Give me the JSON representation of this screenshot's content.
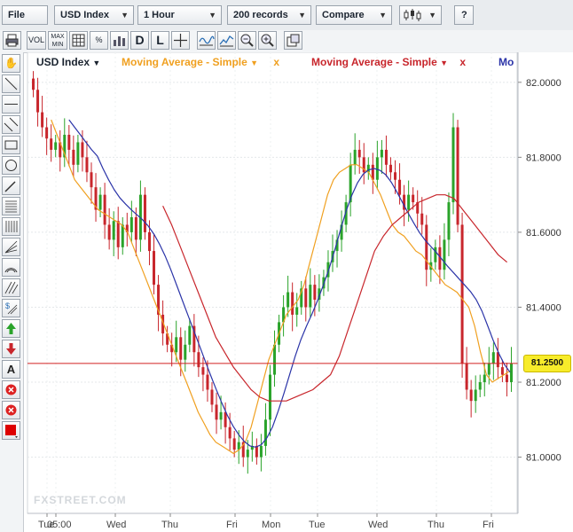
{
  "toolbar": {
    "file": "File",
    "instrument": "USD Index",
    "timeframe": "1 Hour",
    "records": "200 records",
    "compare": "Compare",
    "help": "?",
    "vol": "VOL",
    "maxmin": "MAX MIN",
    "pct": "%",
    "d": "D",
    "l": "L"
  },
  "legend": {
    "instrument": "USD Index",
    "ma1": "Moving Average - Simple",
    "ma2": "Moving Average - Simple",
    "ma3": "Mo",
    "remove": "x",
    "dropdown": "▼"
  },
  "colors": {
    "up": "#2aa32a",
    "down": "#c8262c",
    "ma_fast": "#f0a020",
    "ma_slow": "#c8262c",
    "ma_mid": "#2b34a8",
    "price_line": "#d02020"
  },
  "price_label": "81.2500",
  "watermark": "FXSTREET.COM",
  "chart_data": {
    "type": "line",
    "title": "USD Index",
    "ylim": [
      80.85,
      82.08
    ],
    "y_ticks": [
      "82.0000",
      "81.8000",
      "81.6000",
      "81.4000",
      "81.2000",
      "81.0000"
    ],
    "y_tick_values": [
      82.0,
      81.8,
      81.6,
      81.4,
      81.2,
      81.0
    ],
    "x_labels": [
      "Tue",
      "05:00",
      "Wed",
      "Thu",
      "Fri",
      "Mon",
      "Tue",
      "Wed",
      "Thu",
      "Fri"
    ],
    "current_price": 81.25,
    "series": [
      {
        "name": "USD Index",
        "type": "candlestick",
        "close": [
          81.98,
          81.92,
          81.88,
          81.85,
          81.82,
          81.84,
          81.8,
          81.86,
          81.82,
          81.78,
          81.84,
          81.8,
          81.76,
          81.72,
          81.66,
          81.7,
          81.62,
          81.58,
          81.63,
          81.56,
          81.62,
          81.6,
          81.64,
          81.58,
          81.7,
          81.6,
          81.55,
          81.46,
          81.38,
          81.33,
          81.3,
          81.28,
          81.32,
          81.26,
          81.3,
          81.35,
          81.28,
          81.24,
          81.22,
          81.18,
          81.14,
          81.1,
          81.12,
          81.08,
          81.05,
          81.02,
          81.04,
          81.0,
          81.02,
          81.03,
          81.0,
          81.03,
          81.1,
          81.22,
          81.3,
          81.36,
          81.4,
          81.44,
          81.38,
          81.4,
          81.45,
          81.4,
          81.46,
          81.42,
          81.45,
          81.48,
          81.52,
          81.55,
          81.58,
          81.62,
          81.68,
          81.78,
          81.82,
          81.8,
          81.76,
          81.78,
          81.74,
          81.8,
          81.82,
          81.78,
          81.76,
          81.74,
          81.7,
          81.66,
          81.7,
          81.68,
          81.65,
          81.62,
          81.5,
          81.52,
          81.56,
          81.5,
          81.58,
          81.68,
          81.88,
          81.62,
          81.25,
          81.18,
          81.15,
          81.18,
          81.2,
          81.22,
          81.25,
          81.28,
          81.24,
          81.22,
          81.2,
          81.25
        ]
      },
      {
        "name": "Moving Average - Simple",
        "type": "line",
        "values": [
          81.9,
          81.86,
          81.82,
          81.78,
          81.74,
          81.72,
          81.7,
          81.68,
          81.66,
          81.65,
          81.64,
          81.63,
          81.62,
          81.6,
          81.56,
          81.52,
          81.48,
          81.44,
          81.4,
          81.36,
          81.32,
          81.28,
          81.24,
          81.2,
          81.16,
          81.12,
          81.09,
          81.06,
          81.04,
          81.03,
          81.02,
          81.01,
          81.02,
          81.04,
          81.08,
          81.14,
          81.2,
          81.26,
          81.3,
          81.34,
          81.38,
          81.4,
          81.42,
          81.46,
          81.52,
          81.58,
          81.64,
          81.7,
          81.74,
          81.76,
          81.77,
          81.78,
          81.78,
          81.77,
          81.76,
          81.73,
          81.7,
          81.66,
          81.62,
          81.6,
          81.59,
          81.57,
          81.55,
          81.54,
          81.52,
          81.5,
          81.48,
          81.46,
          81.45,
          81.44,
          81.42,
          81.4,
          81.35,
          81.28,
          81.22,
          81.2,
          81.21,
          81.22,
          81.23
        ]
      },
      {
        "name": "Moving Average - Simple",
        "type": "line",
        "values": [
          81.67,
          81.62,
          81.56,
          81.5,
          81.44,
          81.38,
          81.32,
          81.28,
          81.24,
          81.21,
          81.18,
          81.16,
          81.15,
          81.15,
          81.15,
          81.16,
          81.17,
          81.18,
          81.2,
          81.22,
          81.27,
          81.34,
          81.41,
          81.48,
          81.55,
          81.59,
          81.62,
          81.64,
          81.66,
          81.68,
          81.69,
          81.7,
          81.7,
          81.69,
          81.66,
          81.63,
          81.6,
          81.57,
          81.54,
          81.52
        ]
      }
    ]
  }
}
